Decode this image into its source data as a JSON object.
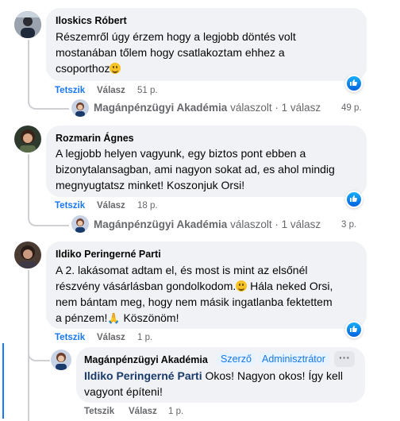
{
  "comments": [
    {
      "author": "Iloskics Róbert",
      "lines": [
        "Részemről úgy érzem hogy a legjobb döntés volt",
        "mostanában tőlem hogy csatlakoztam ehhez a",
        "csoporthoz"
      ],
      "like_label": "Tetszik",
      "reply_label": "Válasz",
      "time": "51 p.",
      "reply_summary": {
        "author": "Magánpénzügyi Akadémia",
        "action": "válaszolt",
        "separator": "·",
        "count": "1 válasz",
        "time": "49 p."
      }
    },
    {
      "author": "Rozmarin Ágnes",
      "lines": [
        "A legjobb helyen vagyunk, egy biztos pont ebben a",
        "bizonytalansagban, ami nagyon sokat ad, es ahol mindig",
        "megnyugtatsz minket! Koszonjuk Orsi!"
      ],
      "like_label": "Tetszik",
      "reply_label": "Válasz",
      "time": "18 p.",
      "reply_summary": {
        "author": "Magánpénzügyi Akadémia",
        "action": "válaszolt",
        "separator": "·",
        "count": "1 válasz",
        "time": "3 p."
      }
    },
    {
      "author": "Ildiko Peringerné Parti",
      "lines": [
        "A 2. lakásomat adtam el, és most is mint az elsőnél",
        "részvény vásárlásban gondolkodom.",
        "Hála neked Orsi,",
        "nem bántam meg, hogy nem másik ingatlanba fektettem",
        "a pénzem!",
        "Köszönöm!"
      ],
      "like_label": "Tetszik",
      "reply_label": "Válasz",
      "time": "1 p."
    }
  ],
  "reply": {
    "author": "Magánpénzügyi Akadémia",
    "badges": [
      "Szerző",
      "Adminisztrátor"
    ],
    "menu_icon": "more-horizontal-icon",
    "mention": "Ildiko Peringerné Parti",
    "lines": [
      "Okos! Nagyon okos! Így kell",
      "vagyont építeni!"
    ],
    "like_label": "Tetszik",
    "reply_label": "Válasz",
    "time": "1 p."
  },
  "colors": {
    "accent": "#1877f2",
    "bubble": "#f0f2f5",
    "muted": "#65676b"
  }
}
